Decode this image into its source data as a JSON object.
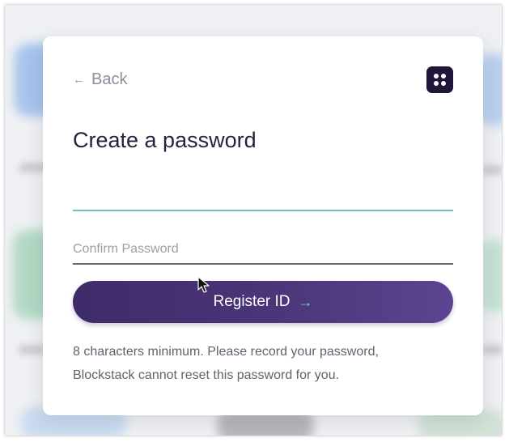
{
  "back": {
    "arrow_glyph": "←",
    "label": "Back"
  },
  "logo": {
    "icon": "blockstack-logo-icon",
    "color": "#21163a"
  },
  "title": "Create a password",
  "password_field": {
    "value": "",
    "accent_color": "#6cc5bd"
  },
  "confirm_field": {
    "placeholder": "Confirm Password",
    "value": ""
  },
  "register_button": {
    "label": "Register ID",
    "arrow_glyph": "→",
    "arrow_color": "#6fd0c7"
  },
  "hint": {
    "line1": "8 characters minimum. Please record your password,",
    "line2": "Blockstack cannot reset this password for you."
  },
  "colors": {
    "primary": "#3e2c69",
    "primary_end": "#5b4590",
    "text_dark": "#2b1f3f",
    "text_muted": "#5e6370"
  }
}
